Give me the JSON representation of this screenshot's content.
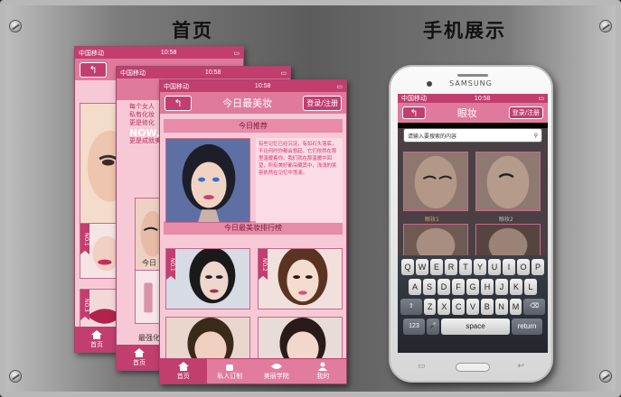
{
  "headings": {
    "left": "首页",
    "right": "手机展示"
  },
  "status": {
    "carrier": "中国移动",
    "time": "10:58"
  },
  "front_phone": {
    "title": "今日最美妆",
    "back_label": "↰",
    "login_label": "登录/注册",
    "section_today": "今日推荐",
    "poem": "有些记忆已经沉淀，有如石头落底，不论何时你都会想起，它们依然在那里温暖着你。我们就在那温暖中回望，所有美好都深藏其中，浅浅的笑容依然在记忆中荡漾。",
    "section_rank": "今日最美妆排行榜",
    "ranks": [
      "NO.1",
      "NO.2"
    ],
    "nav": [
      "首页",
      "私人订制",
      "美丽学院",
      "我的"
    ]
  },
  "mid_phone": {
    "text_lines": [
      "每个女人",
      "私有化妆",
      "更是修化"
    ],
    "now_line": "NOW,",
    "now_sub": "更是成就美",
    "caption": "今日",
    "caption2": "最强化",
    "nav_home": "首页"
  },
  "back_phone": {
    "ranks": [
      "NO.1",
      "NO.3"
    ],
    "nav_home": "首页"
  },
  "device": {
    "brand": "SAMSUNG",
    "title": "眼妆",
    "login_label": "登录/注册",
    "search_placeholder": "请输入要搜索的内容",
    "item_labels": [
      "眼妆1",
      "眼妆2"
    ],
    "keyboard": {
      "row1": [
        "Q",
        "W",
        "E",
        "R",
        "T",
        "Y",
        "U",
        "I",
        "O",
        "P"
      ],
      "row2": [
        "A",
        "S",
        "D",
        "F",
        "G",
        "H",
        "J",
        "K",
        "L"
      ],
      "row3": [
        "Z",
        "X",
        "C",
        "V",
        "B",
        "N",
        "M"
      ],
      "shift": "⇧",
      "delete": "⌫",
      "num": "123",
      "mic": "🎤",
      "space": "space",
      "return": "return"
    }
  },
  "colors": {
    "pink_dark": "#c23e6f",
    "pink_mid": "#e07a9c",
    "pink_light": "#f7c9d6"
  }
}
